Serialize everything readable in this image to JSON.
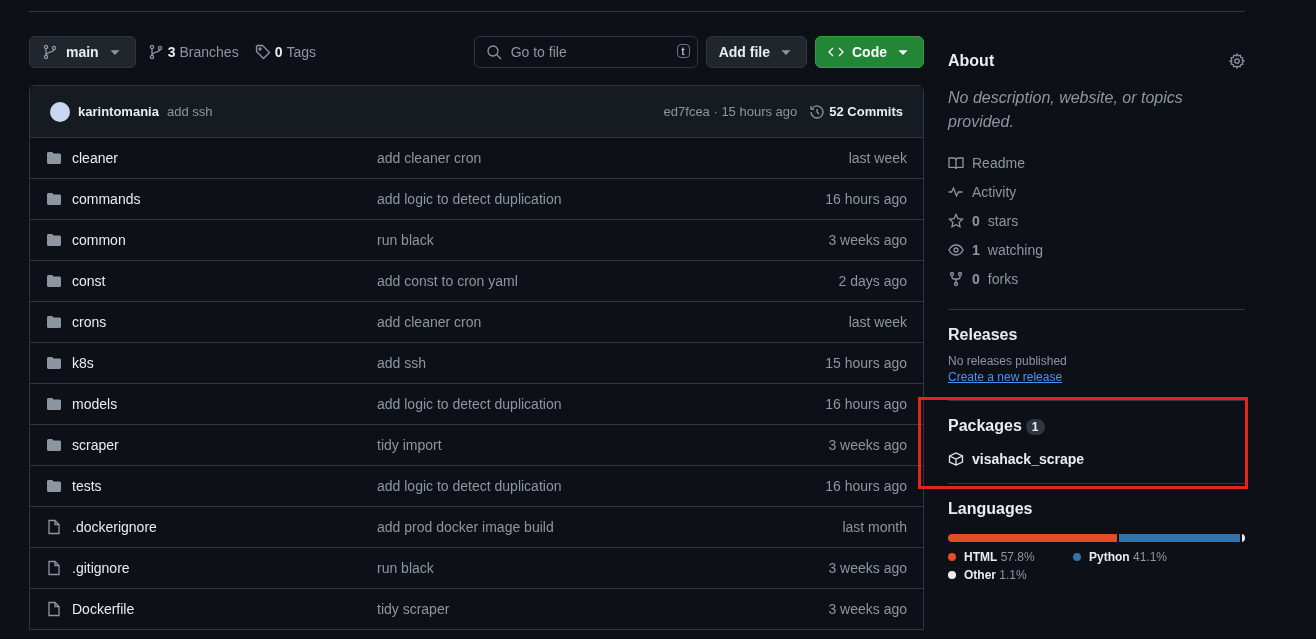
{
  "toolbar": {
    "branch": "main",
    "branches_count": "3",
    "branches_label": "Branches",
    "tags_count": "0",
    "tags_label": "Tags",
    "search": {
      "placeholder": "Go to file",
      "shortcut": "t"
    },
    "add_file": "Add file",
    "code": "Code"
  },
  "commit": {
    "author": "karintomania",
    "message": "add ssh",
    "hash": "ed7fcea",
    "separator": "·",
    "time": "15 hours ago",
    "commits": "52 Commits"
  },
  "files": [
    {
      "kind": "folder",
      "name": "cleaner",
      "message": "add cleaner cron",
      "time": "last week"
    },
    {
      "kind": "folder",
      "name": "commands",
      "message": "add logic to detect duplication",
      "time": "16 hours ago"
    },
    {
      "kind": "folder",
      "name": "common",
      "message": "run black",
      "time": "3 weeks ago"
    },
    {
      "kind": "folder",
      "name": "const",
      "message": "add const to cron yaml",
      "time": "2 days ago"
    },
    {
      "kind": "folder",
      "name": "crons",
      "message": "add cleaner cron",
      "time": "last week"
    },
    {
      "kind": "folder",
      "name": "k8s",
      "message": "add ssh",
      "time": "15 hours ago"
    },
    {
      "kind": "folder",
      "name": "models",
      "message": "add logic to detect duplication",
      "time": "16 hours ago"
    },
    {
      "kind": "folder",
      "name": "scraper",
      "message": "tidy import",
      "time": "3 weeks ago"
    },
    {
      "kind": "folder",
      "name": "tests",
      "message": "add logic to detect duplication",
      "time": "16 hours ago"
    },
    {
      "kind": "file",
      "name": ".dockerignore",
      "message": "add prod docker image build",
      "time": "last month"
    },
    {
      "kind": "file",
      "name": ".gitignore",
      "message": "run black",
      "time": "3 weeks ago"
    },
    {
      "kind": "file",
      "name": "Dockerfile",
      "message": "tidy scraper",
      "time": "3 weeks ago"
    }
  ],
  "about": {
    "title": "About",
    "description": "No description, website, or topics provided.",
    "items": [
      {
        "kind": "book",
        "label": "Readme"
      },
      {
        "kind": "pulse",
        "label": "Activity"
      },
      {
        "kind": "star",
        "count": "0",
        "label": "stars"
      },
      {
        "kind": "eye",
        "count": "1",
        "label": "watching"
      },
      {
        "kind": "fork",
        "count": "0",
        "label": "forks"
      }
    ]
  },
  "releases": {
    "title": "Releases",
    "note": "No releases published",
    "link": "Create a new release"
  },
  "packages": {
    "title": "Packages",
    "count": "1",
    "items": [
      "visahack_scrape"
    ],
    "highlighted": true
  },
  "languages": {
    "title": "Languages",
    "items": [
      {
        "name": "HTML",
        "percent": "57.8%",
        "level": 0.578,
        "color": "#e34c26"
      },
      {
        "name": "Python",
        "percent": "41.1%",
        "level": 0.411,
        "color": "#3572a5"
      },
      {
        "name": "Other",
        "percent": "1.1%",
        "level": 0.011,
        "color": "#ededed"
      }
    ]
  }
}
